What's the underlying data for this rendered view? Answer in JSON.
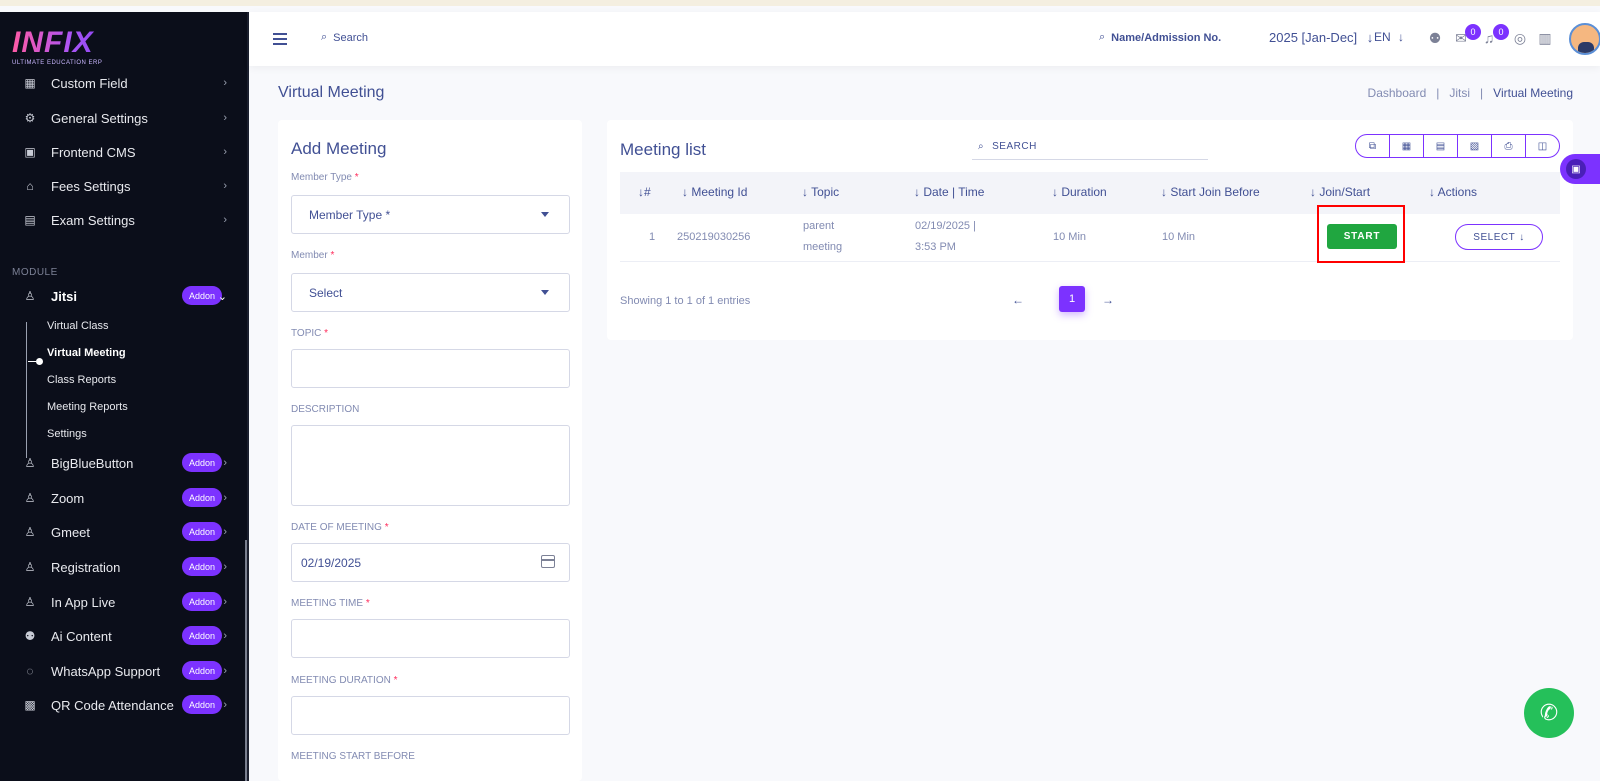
{
  "logo": {
    "word": "INFIX",
    "tagline": "ULTIMATE EDUCATION ERP"
  },
  "sidebar": {
    "items": [
      {
        "label": "Custom Field",
        "icon": "grid-icon"
      },
      {
        "label": "General Settings",
        "icon": "gears-icon"
      },
      {
        "label": "Frontend CMS",
        "icon": "monitor-icon"
      },
      {
        "label": "Fees Settings",
        "icon": "bank-icon"
      },
      {
        "label": "Exam Settings",
        "icon": "book-icon"
      }
    ],
    "module_label": "MODULE",
    "jitsi": {
      "label": "Jitsi",
      "addon": "Addon"
    },
    "jitsi_sub": [
      "Virtual Class",
      "Virtual Meeting",
      "Class Reports",
      "Meeting Reports",
      "Settings"
    ],
    "modules": [
      {
        "label": "BigBlueButton",
        "addon": "Addon"
      },
      {
        "label": "Zoom",
        "addon": "Addon"
      },
      {
        "label": "Gmeet",
        "addon": "Addon"
      },
      {
        "label": "Registration",
        "addon": "Addon"
      },
      {
        "label": "In App Live",
        "addon": "Addon"
      },
      {
        "label": "Ai Content",
        "addon": "Addon"
      },
      {
        "label": "WhatsApp Support",
        "addon": "Addon"
      },
      {
        "label": "QR Code Attendance",
        "addon": "Addon"
      }
    ]
  },
  "header": {
    "search_label": "Search",
    "name_search_label": "Name/Admission No.",
    "year": "2025 [Jan-Dec]",
    "lang": "EN",
    "chat_count": "0",
    "notif_count": "0"
  },
  "page": {
    "title": "Virtual Meeting",
    "breadcrumb": [
      "Dashboard",
      "Jitsi",
      "Virtual Meeting"
    ],
    "breadcrumb_sep": "|"
  },
  "form": {
    "title": "Add Meeting",
    "member_type_label": "Member Type",
    "member_type_value": "Member Type *",
    "member_label": "Member",
    "member_value": "Select",
    "topic_label": "TOPIC",
    "description_label": "DESCRIPTION",
    "date_label": "DATE OF MEETING",
    "date_value": "02/19/2025",
    "time_label": "MEETING TIME",
    "duration_label": "MEETING DURATION",
    "start_before_label": "MEETING START BEFORE",
    "required_mark": "*"
  },
  "list": {
    "title": "Meeting list",
    "search_label": "SEARCH",
    "columns": [
      "#",
      "Meeting Id",
      "Topic",
      "Date | Time",
      "Duration",
      "Start Join Before",
      "Join/Start",
      "Actions"
    ],
    "rows": [
      {
        "num": "1",
        "meeting_id": "250219030256",
        "topic_line1": "parent",
        "topic_line2": "meeting",
        "date_line1": "02/19/2025 |",
        "date_line2": "3:53 PM",
        "duration": "10 Min",
        "join_before": "10 Min",
        "start_label": "START",
        "action_label": "SELECT"
      }
    ],
    "showing": "Showing 1 to 1 of 1 entries",
    "page": "1",
    "prev": "←",
    "next": "→"
  },
  "colors": {
    "accent": "#7c32ff",
    "text": "#415094",
    "start": "#20a640",
    "highlight": "#ff0000",
    "sidebar": "#0b0e1a"
  }
}
